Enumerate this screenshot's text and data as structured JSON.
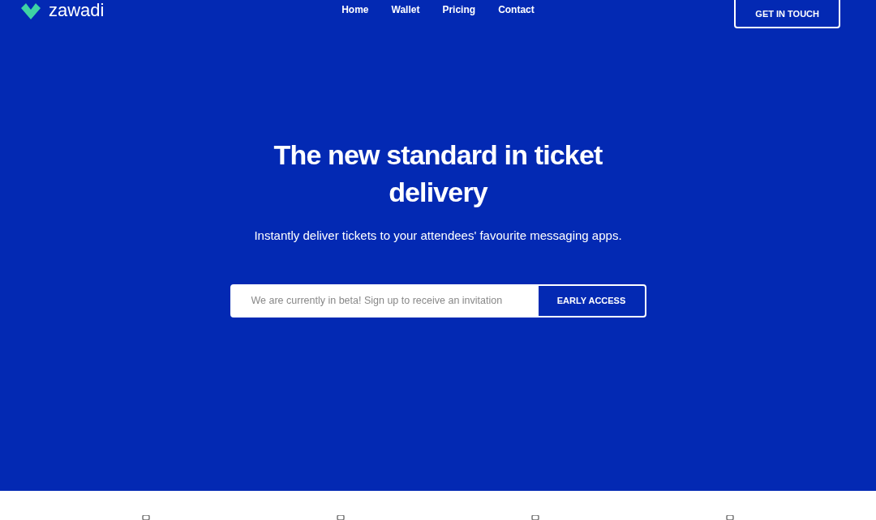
{
  "header": {
    "logo_text": "zawadi",
    "nav": [
      {
        "label": "Home"
      },
      {
        "label": "Wallet"
      },
      {
        "label": "Pricing"
      },
      {
        "label": "Contact"
      }
    ],
    "cta": "GET IN TOUCH"
  },
  "hero": {
    "title": "The new standard in ticket delivery",
    "subtitle": "Instantly deliver tickets to your attendees' favourite messaging apps.",
    "signup": {
      "placeholder": "We are currently in beta! Sign up to receive an invitation",
      "button": "EARLY ACCESS"
    }
  },
  "features": [
    {
      "kind": "icon"
    },
    {
      "kind": "icon"
    },
    {
      "kind": "icon"
    },
    {
      "kind": "icon"
    }
  ]
}
